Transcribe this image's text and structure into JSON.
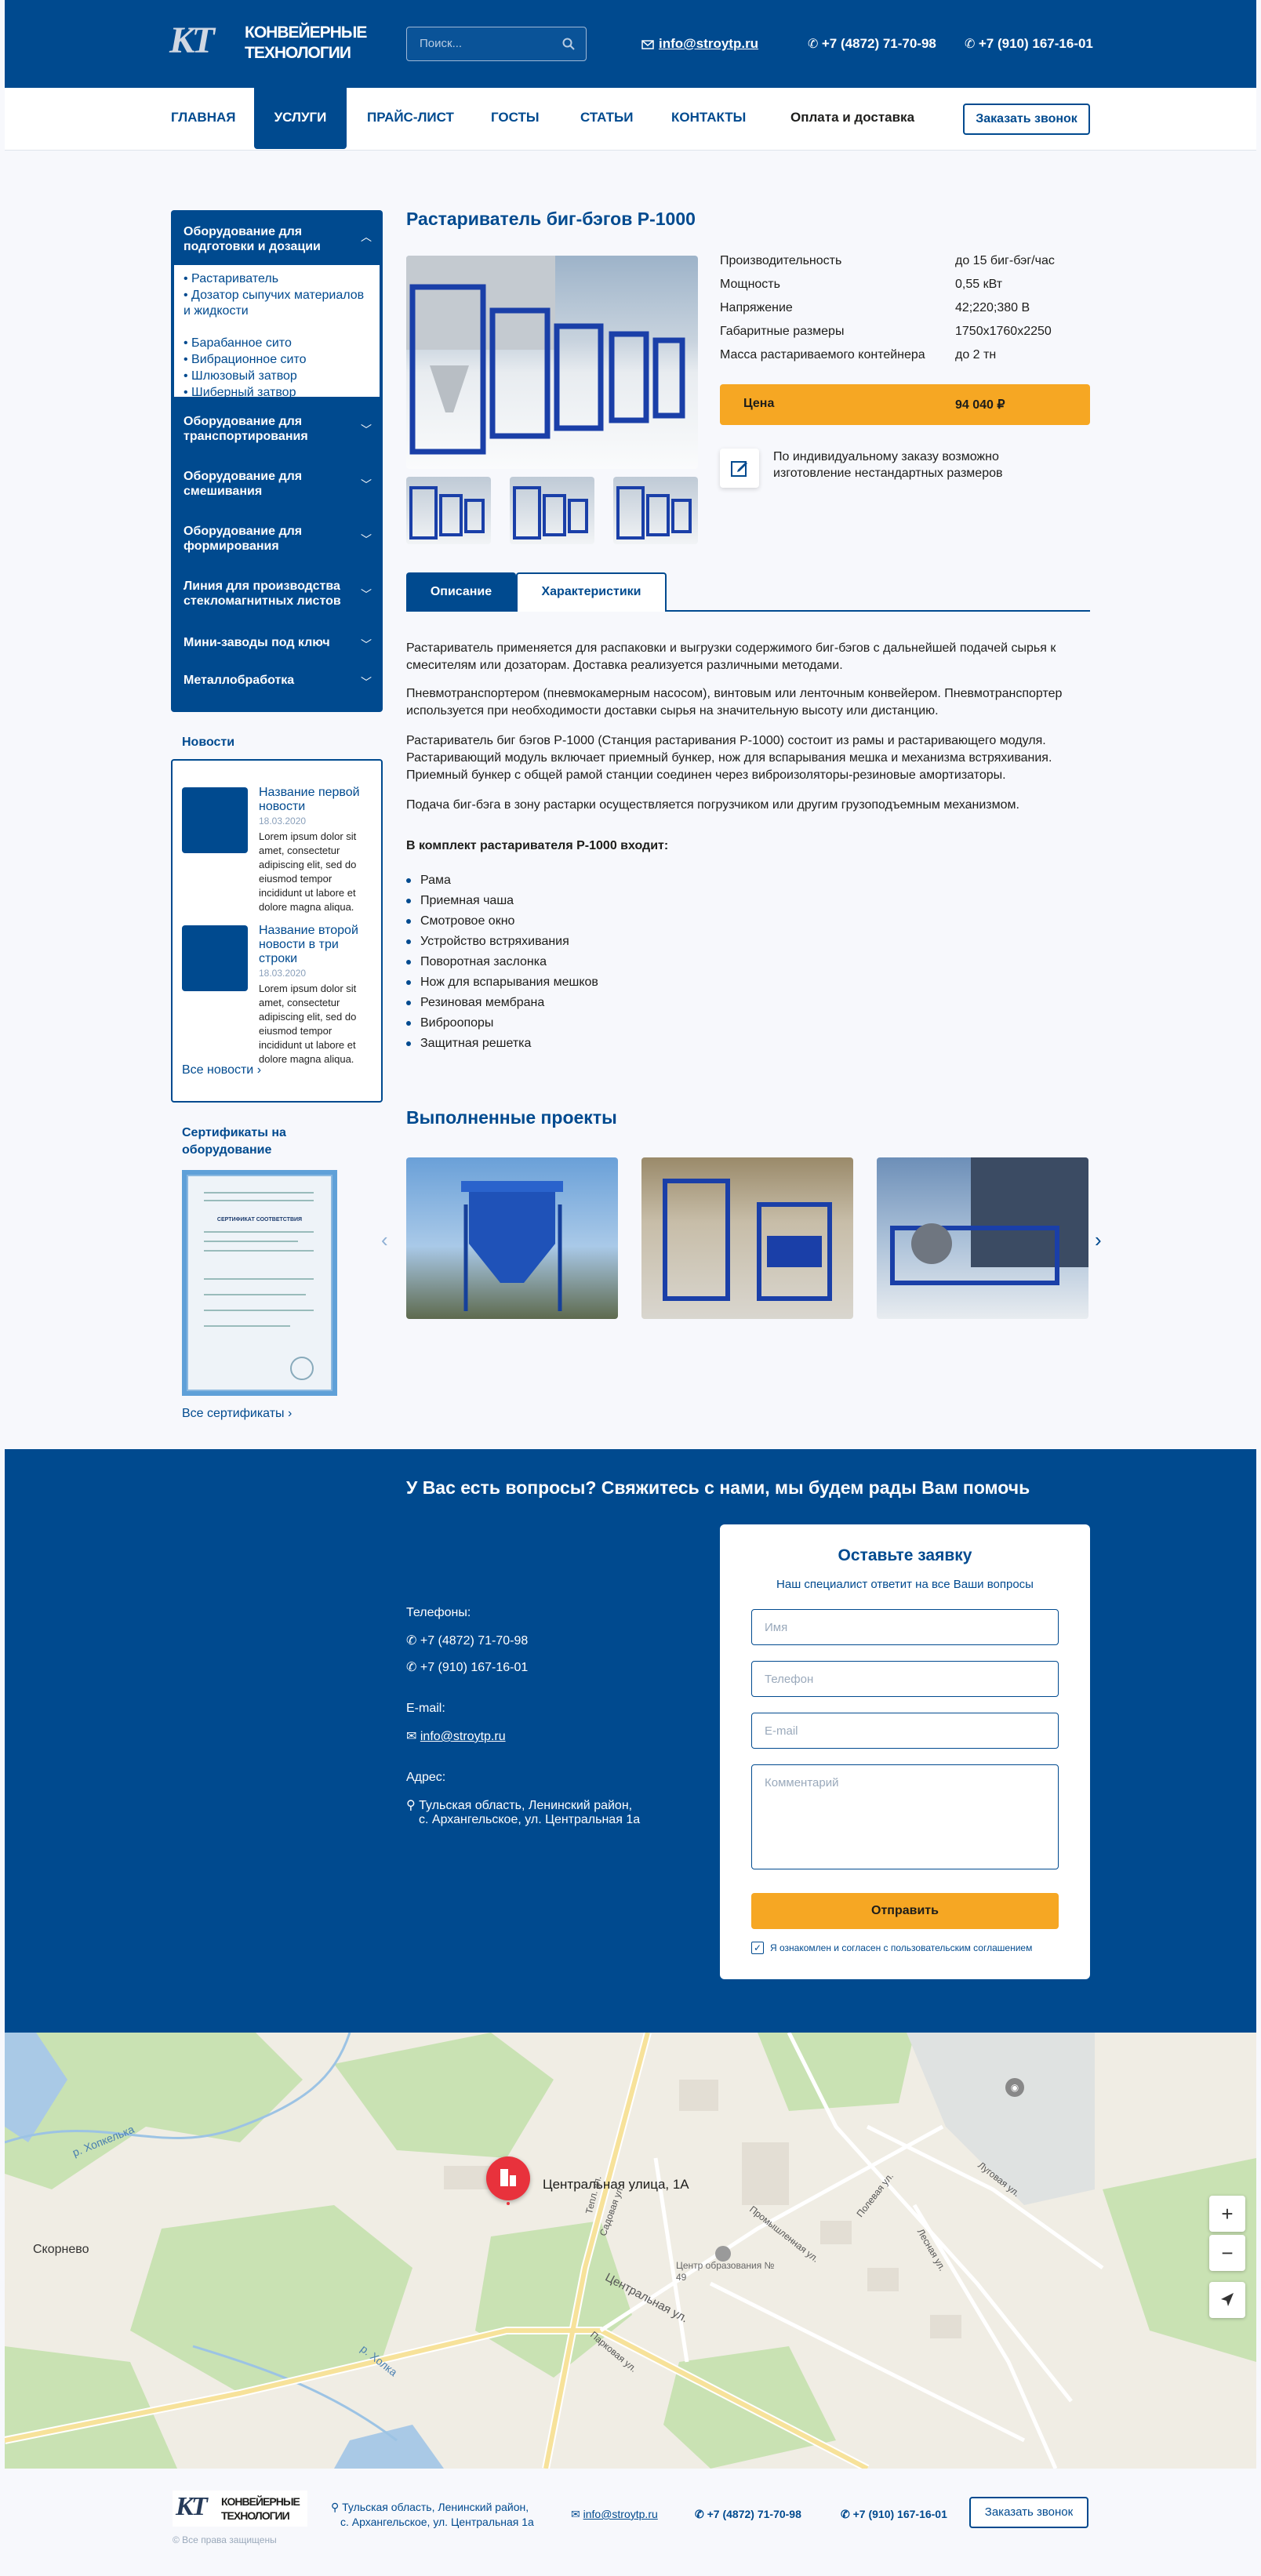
{
  "header": {
    "logo_letters": "КТ",
    "logo_line1": "КОНВЕЙЕРНЫЕ",
    "logo_line2": "ТЕХНОЛОГИИ",
    "search_placeholder": "Поиск...",
    "email": "info@stroytp.ru",
    "phone1": "+7 (4872) 71-70-98",
    "phone2": "+7 (910) 167-16-01"
  },
  "nav": {
    "items": [
      "ГЛАВНАЯ",
      "УСЛУГИ",
      "ПРАЙС-ЛИСТ",
      "ГОСТЫ",
      "СТАТЬИ",
      "КОНТАКТЫ",
      "Оплата и доставка"
    ],
    "callback": "Заказать звонок"
  },
  "sidebar": {
    "cat1": "Оборудование для подготовки и дозации",
    "sub": [
      "Растариватель",
      "Дозатор сыпучих материалов и жидкости",
      "Барабанное сито",
      "Вибрационное сито",
      "Шлюзовый затвор",
      "Шиберный затвор"
    ],
    "cats": [
      "Оборудование для транспортирования",
      "Оборудование для смешивания",
      "Оборудование для формирования",
      "Линия для производства стекломагнитных листов",
      "Мини-заводы под ключ",
      "Металлобработка"
    ]
  },
  "news": {
    "title": "Новости",
    "items": [
      {
        "title": "Название первой новости",
        "date": "18.03.2020",
        "text": "Lorem ipsum dolor sit amet, consectetur adipiscing elit, sed do eiusmod tempor incididunt ut labore et dolore magna aliqua."
      },
      {
        "title": "Название второй новости в три строки",
        "date": "18.03.2020",
        "text": "Lorem ipsum dolor sit amet, consectetur adipiscing elit, sed do eiusmod tempor incididunt ut labore et dolore magna aliqua."
      }
    ],
    "all": "Все новости"
  },
  "certs": {
    "title": "Сертификаты на оборудование",
    "all": "Все сертификаты",
    "doc_title": "СЕРТИФИКАТ СООТВЕТСТВИЯ"
  },
  "product": {
    "title": "Растариватель биг-бэгов Р-1000",
    "specs": [
      {
        "k": "Производительность",
        "v": "до 15 биг-бэг/час"
      },
      {
        "k": "Мощность",
        "v": "0,55 кВт"
      },
      {
        "k": "Напряжение",
        "v": "42;220;380 В"
      },
      {
        "k": "Габаритные размеры",
        "v": "1750х1760х2250"
      },
      {
        "k": "Масса растариваемого контейнера",
        "v": "до 2 тн"
      }
    ],
    "price_label": "Цена",
    "price": "94 040 ₽",
    "custom_note": "По индивидуальному заказу возможно изготовление нестандартных размеров",
    "tab1": "Описание",
    "tab2": "Характеристики",
    "p1": "Растариватель применяется для распаковки и выгрузки содержимого биг-бэгов с дальнейшей подачей сырья к смесителям или дозаторам. Доставка реализуется различными методами.",
    "p2": "Пневмотранспортером (пневмокамерным насосом), винтовым или ленточным конвейером. Пневмотранспортер используется при необходимости доставки сырья на значительную высоту или дистанцию.",
    "p3": "Растариватель биг бэгов Р-1000 (Станция растаривания Р-1000) состоит из рамы и растаривающего модуля. Растаривающий модуль включает приемный бункер, нож для вспарывания мешка и механизма встряхивания. Приемный бункер с общей рамой станции соединен через виброизоляторы-резиновые амортизаторы.",
    "p4": "Подача биг-бэга в зону растарки осуществляется погрузчиком или другим грузоподъемным механизмом.",
    "kit_title": "В комплект растаривателя Р-1000 входит:",
    "kit": [
      "Рама",
      "Приемная чаша",
      "Смотровое окно",
      "Устройство встряхивания",
      "Поворотная заслонка",
      "Нож для вспарывания мешков",
      "Резиновая мембрана",
      "Виброопоры",
      "Защитная решетка"
    ]
  },
  "projects": {
    "title": "Выполненные проекты"
  },
  "contact": {
    "heading": "У Вас есть вопросы? Свяжитесь с нами, мы будем рады Вам помочь",
    "phones_label": "Телефоны:",
    "phone1": "+7 (4872) 71-70-98",
    "phone2": "+7 (910) 167-16-01",
    "email_label": "E-mail:",
    "email": "info@stroytp.ru",
    "addr_label": "Адрес:",
    "addr1": "Тульская область, Ленинский район,",
    "addr2": "с. Архангельское, ул. Центральная 1а",
    "form_title": "Оставьте заявку",
    "form_sub": "Наш специалист ответит на все Ваши вопросы",
    "name_ph": "Имя",
    "phone_ph": "Телефон",
    "email_ph": "E-mail",
    "comment_ph": "Комментарий",
    "submit": "Отправить",
    "agree": "Я ознакомлен и согласен с пользовательским соглашением"
  },
  "map": {
    "pin_label": "Центральная улица, 1А",
    "village": "Скорнево",
    "river1": "р. Хопкелька",
    "river2": "р. Холка",
    "center": "Центр образования № 49",
    "streets": [
      "Центральная ул.",
      "Садовая ул.",
      "Промышленная ул.",
      "Полевая ул.",
      "Луговая ул.",
      "Лесная ул.",
      "Парковая ул.",
      "Тепл. ул."
    ]
  },
  "footer": {
    "addr1": "Тульская область, Ленинский район,",
    "addr2": "с. Архангельское, ул. Центральная 1а",
    "email": "info@stroytp.ru",
    "phone1": "+7 (4872)  71-70-98",
    "phone2": "+7 (910) 167-16-01",
    "callback": "Заказать звонок",
    "rights": "©  Все права защищены"
  }
}
